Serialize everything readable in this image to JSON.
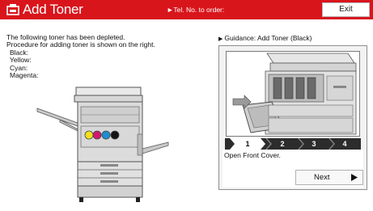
{
  "header": {
    "title": "Add Toner",
    "tel_link": "►Tel. No. to order:",
    "exit_label": "Exit"
  },
  "message": {
    "line1": "The following toner has been depleted.",
    "line2": "Procedure for adding toner is shown on the right.",
    "colors": [
      "Black:",
      "Yellow:",
      "Cyan:",
      "Magenta:"
    ]
  },
  "guidance": {
    "header_arrow": "▶",
    "header": "Guidance: Add Toner (Black)",
    "steps": [
      "1",
      "2",
      "3",
      "4"
    ],
    "current_step": 1,
    "caption": "Open Front Cover.",
    "next_label": "Next"
  },
  "toner_colors": {
    "yellow": "#f0e11e",
    "magenta": "#d2186e",
    "cyan": "#1e8ed2",
    "black": "#151515"
  },
  "theme": {
    "title_bar": "#d9151c",
    "step_bar": "#2c2c2c"
  },
  "icons": {
    "title": "toner-cartridge-icon",
    "next": "triangle-right-icon"
  }
}
